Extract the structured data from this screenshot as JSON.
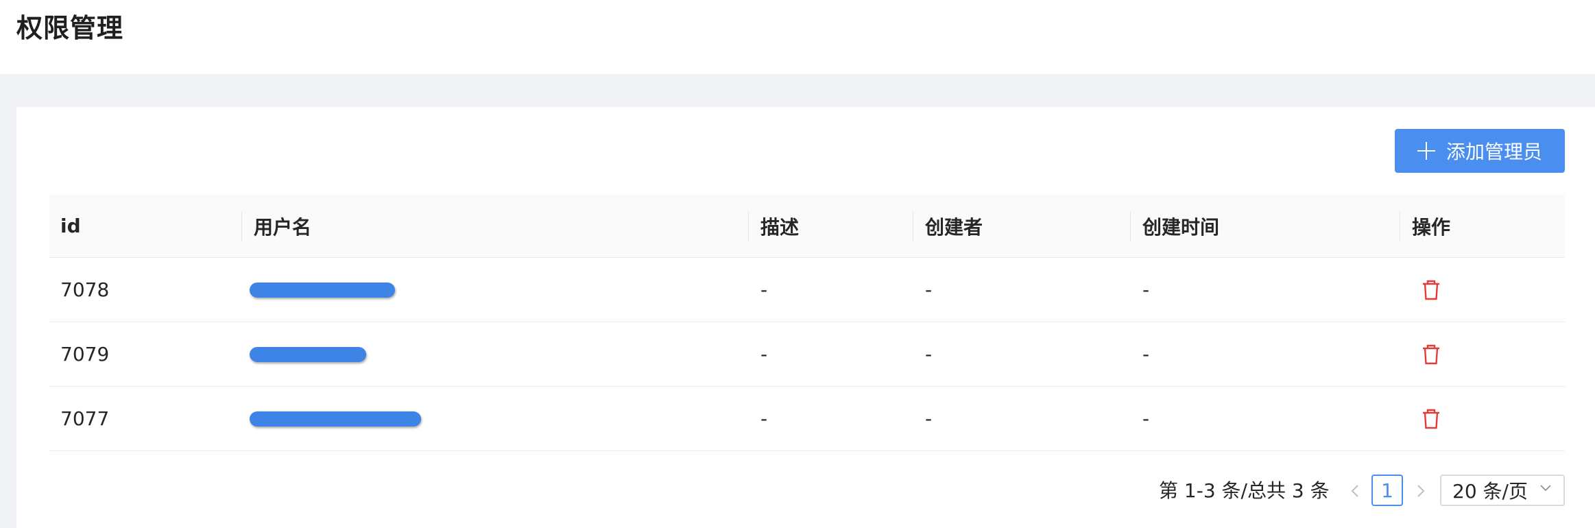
{
  "header": {
    "title": "权限管理"
  },
  "toolbar": {
    "add_label": "添加管理员",
    "add_icon": "plus-icon"
  },
  "table": {
    "columns": [
      "id",
      "用户名",
      "描述",
      "创建者",
      "创建时间",
      "操作"
    ],
    "rows": [
      {
        "id": "7078",
        "username": "redacted",
        "desc": "-",
        "creator": "-",
        "created_at": "-",
        "action_icon": "trash-icon"
      },
      {
        "id": "7079",
        "username": "redacted",
        "desc": "-",
        "creator": "-",
        "created_at": "-",
        "action_icon": "trash-icon"
      },
      {
        "id": "7077",
        "username": "redacted",
        "desc": "-",
        "creator": "-",
        "created_at": "-",
        "action_icon": "trash-icon"
      }
    ]
  },
  "pagination": {
    "total_text": "第 1-3 条/总共 3 条",
    "prev_icon": "chevron-left-icon",
    "current_page": "1",
    "next_icon": "chevron-right-icon",
    "page_size": "20 条/页",
    "page_size_icon": "chevron-down-icon"
  },
  "colors": {
    "primary": "#4a8ff0",
    "danger": "#e23b3b",
    "background": "#f0f2f5"
  }
}
